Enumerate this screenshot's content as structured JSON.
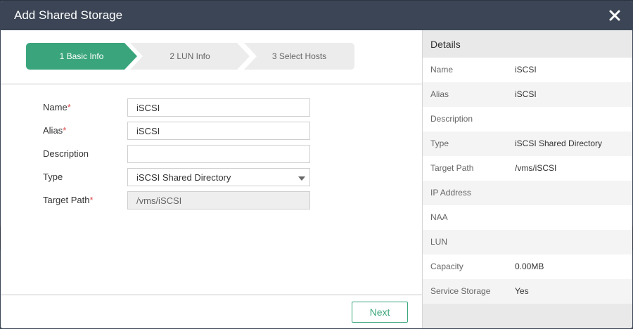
{
  "dialog": {
    "title": "Add Shared Storage",
    "close_icon": "close-icon"
  },
  "steps": [
    {
      "label": "1 Basic Info",
      "active": true
    },
    {
      "label": "2 LUN Info",
      "active": false
    },
    {
      "label": "3 Select Hosts",
      "active": false
    }
  ],
  "form": {
    "name": {
      "label": "Name",
      "value": "iSCSI",
      "required": true
    },
    "alias": {
      "label": "Alias",
      "value": "iSCSI",
      "required": true
    },
    "description": {
      "label": "Description",
      "value": "",
      "required": false
    },
    "type": {
      "label": "Type",
      "value": "iSCSI Shared Directory",
      "required": false
    },
    "target_path": {
      "label": "Target Path",
      "value": "/vms/iSCSI",
      "required": true,
      "disabled": true
    },
    "required_mark": "*"
  },
  "footer": {
    "next_label": "Next"
  },
  "details": {
    "title": "Details",
    "rows": [
      {
        "key": "Name",
        "value": "iSCSI"
      },
      {
        "key": "Alias",
        "value": "iSCSI"
      },
      {
        "key": "Description",
        "value": ""
      },
      {
        "key": "Type",
        "value": "iSCSI Shared Directory"
      },
      {
        "key": "Target Path",
        "value": "/vms/iSCSI"
      },
      {
        "key": "IP Address",
        "value": ""
      },
      {
        "key": "NAA",
        "value": ""
      },
      {
        "key": "LUN",
        "value": ""
      },
      {
        "key": "Capacity",
        "value": "0.00MB"
      },
      {
        "key": "Service Storage",
        "value": "Yes"
      }
    ]
  },
  "colors": {
    "accent": "#3aa57c",
    "titlebar": "#3b4555",
    "required": "#e04b4b"
  }
}
